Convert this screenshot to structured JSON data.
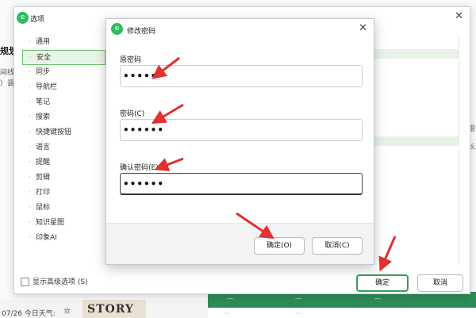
{
  "background": {
    "title_fragment": "规划",
    "side_fragment_1": "间线",
    "side_fragment_2": "）调",
    "date_text": "07/26 今日天气:",
    "image_text": "STORY",
    "right_fragment_1": "根",
    "right_fragment_2": "长"
  },
  "options_dialog": {
    "title": "选项",
    "sidebar_items": [
      {
        "label": "通用"
      },
      {
        "label": "安全"
      },
      {
        "label": "同步"
      },
      {
        "label": "导航栏"
      },
      {
        "label": "笔记"
      },
      {
        "label": "搜索"
      },
      {
        "label": "快捷键按钮"
      },
      {
        "label": "语言"
      },
      {
        "label": "提醒"
      },
      {
        "label": "剪辑"
      },
      {
        "label": "打印"
      },
      {
        "label": "鼠标"
      },
      {
        "label": "知识星图"
      },
      {
        "label": "印象AI"
      }
    ],
    "selected_item": "安全",
    "show_advanced_label": "显示高级选项 (S)",
    "ok_label": "确定",
    "cancel_label": "取消"
  },
  "password_dialog": {
    "title": "修改密码",
    "old_password_label": "原密码",
    "old_password_value": "••••••",
    "new_password_label": "密码(C)",
    "new_password_value": "••••••",
    "confirm_password_label": "确认密码(E)",
    "confirm_password_value": "••••••",
    "ok_label": "确定(O)",
    "cancel_label": "取消(C)"
  },
  "colors": {
    "brand_green": "#2dbe60",
    "selected_border": "#6cc06c",
    "arrow_red": "#e03030"
  }
}
